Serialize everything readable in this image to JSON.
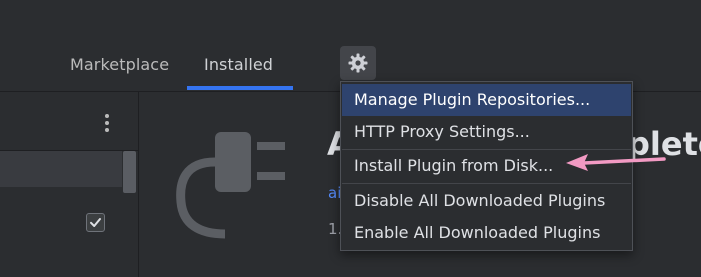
{
  "tabs": {
    "marketplace": "Marketplace",
    "installed": "Installed",
    "settings_icon": "gear-icon"
  },
  "left_panel": {
    "more_icon": "kebab-icon",
    "checkbox_checked": true
  },
  "plugin": {
    "title_left": "A",
    "title_right": "plete",
    "vendor_fragment": "ai",
    "version_fragment": "1."
  },
  "menu": {
    "items": [
      {
        "label": "Manage Plugin Repositories...",
        "selected": true
      },
      {
        "label": "HTTP Proxy Settings...",
        "selected": false
      },
      {
        "label": "Install Plugin from Disk...",
        "selected": false
      },
      {
        "label": "Disable All Downloaded Plugins",
        "selected": false
      },
      {
        "label": "Enable All Downloaded Plugins",
        "selected": false
      }
    ]
  },
  "annotation": {
    "arrow_color": "#f29ac3"
  },
  "colors": {
    "accent": "#3574f0",
    "selection": "#2e436e",
    "link": "#548af7",
    "background": "#2b2d30"
  }
}
